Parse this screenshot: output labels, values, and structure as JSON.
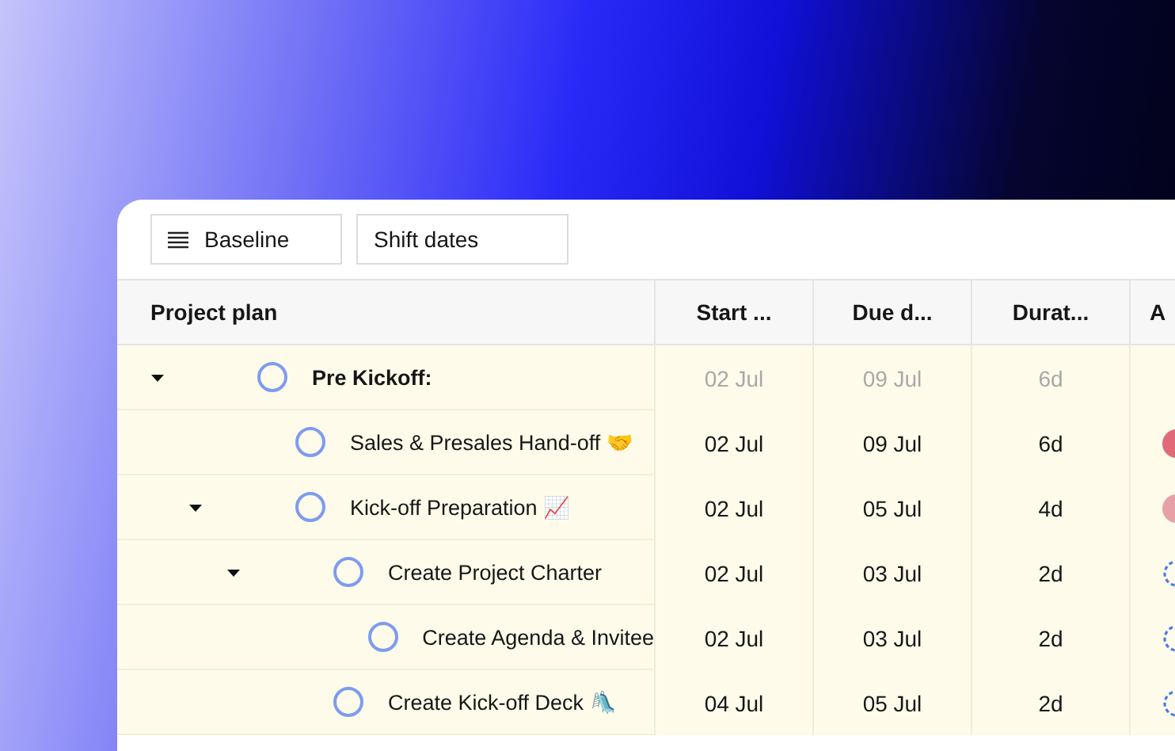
{
  "toolbar": {
    "buttons": [
      {
        "label": "Baseline"
      },
      {
        "label": "Shift dates"
      }
    ]
  },
  "table": {
    "columns": [
      "Project plan",
      "Start ...",
      "Due d...",
      "Durat...",
      "A"
    ],
    "rows": [
      {
        "summary": true,
        "name": "Pre Kickoff:",
        "expanded": true,
        "start": "02 Jul",
        "due": "09 Jul",
        "duration": "6d",
        "children": [
          {
            "summary": false,
            "name": "Sales & Presales Hand-off 🤝",
            "start": "02 Jul",
            "due": "09 Jul",
            "duration": "6d",
            "assignee": {
              "kind": "person",
              "color": "#e06a78"
            }
          },
          {
            "summary": false,
            "name": "Kick-off Preparation 📈",
            "expanded": true,
            "start": "02 Jul",
            "due": "05 Jul",
            "duration": "4d",
            "assignee": {
              "kind": "person",
              "color": "#e8a0a8"
            },
            "children": [
              {
                "summary": false,
                "name": "Create Project Charter",
                "expanded": true,
                "start": "02 Jul",
                "due": "03 Jul",
                "duration": "2d",
                "assignee": {
                  "kind": "unassigned"
                },
                "children": [
                  {
                    "summary": false,
                    "name": "Create Agenda & Invitee",
                    "start": "02 Jul",
                    "due": "03 Jul",
                    "duration": "2d",
                    "assignee": {
                      "kind": "unassigned"
                    }
                  }
                ]
              },
              {
                "summary": false,
                "name": "Create Kick-off Deck 🛝",
                "start": "04 Jul",
                "due": "05 Jul",
                "duration": "2d",
                "assignee": {
                  "kind": "unassigned"
                }
              }
            ]
          }
        ]
      }
    ]
  }
}
